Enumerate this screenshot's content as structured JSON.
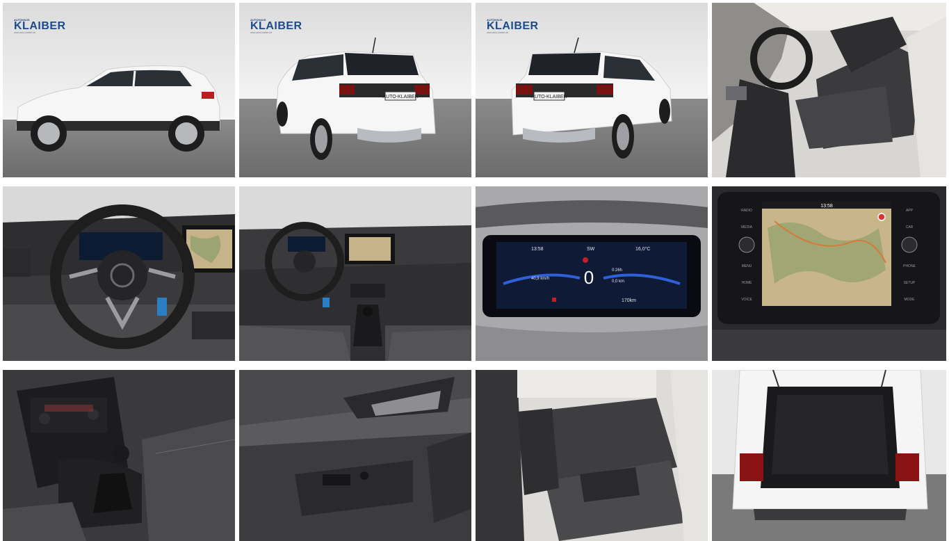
{
  "dealer": {
    "logo_top": "AUTOHAUS",
    "logo_name": "KLAIBER",
    "logo_tagline": "www.auto-klaiber.de"
  },
  "plate_text": "AUTO-KLAIBER",
  "cluster": {
    "time": "13:58",
    "heading": "SW",
    "temp": "16,0°C",
    "speed": "0",
    "trip_time": "0:26h",
    "range": "170km",
    "consumption": "40,9 km/h",
    "distance": "0,0 km"
  },
  "infotainment": {
    "time": "13:58",
    "left_buttons": [
      "RADIO",
      "MEDIA",
      "MENU",
      "HOME",
      "VOICE"
    ],
    "right_buttons": [
      "APP",
      "CAR",
      "PHONE",
      "SETUP",
      "MODE"
    ]
  },
  "tiles": [
    {
      "id": "exterior-side",
      "icon": "car-photo"
    },
    {
      "id": "exterior-rear-left",
      "icon": "car-photo"
    },
    {
      "id": "exterior-rear-right",
      "icon": "car-photo"
    },
    {
      "id": "front-seats",
      "icon": "seat-photo"
    },
    {
      "id": "steering-wheel",
      "icon": "dashboard-photo"
    },
    {
      "id": "cockpit",
      "icon": "dashboard-photo"
    },
    {
      "id": "instrument-cluster",
      "icon": "cluster-photo"
    },
    {
      "id": "infotainment-screen",
      "icon": "screen-photo"
    },
    {
      "id": "center-console",
      "icon": "console-photo"
    },
    {
      "id": "door-panel",
      "icon": "door-photo"
    },
    {
      "id": "rear-seats",
      "icon": "seat-photo"
    },
    {
      "id": "trunk",
      "icon": "trunk-photo"
    }
  ]
}
